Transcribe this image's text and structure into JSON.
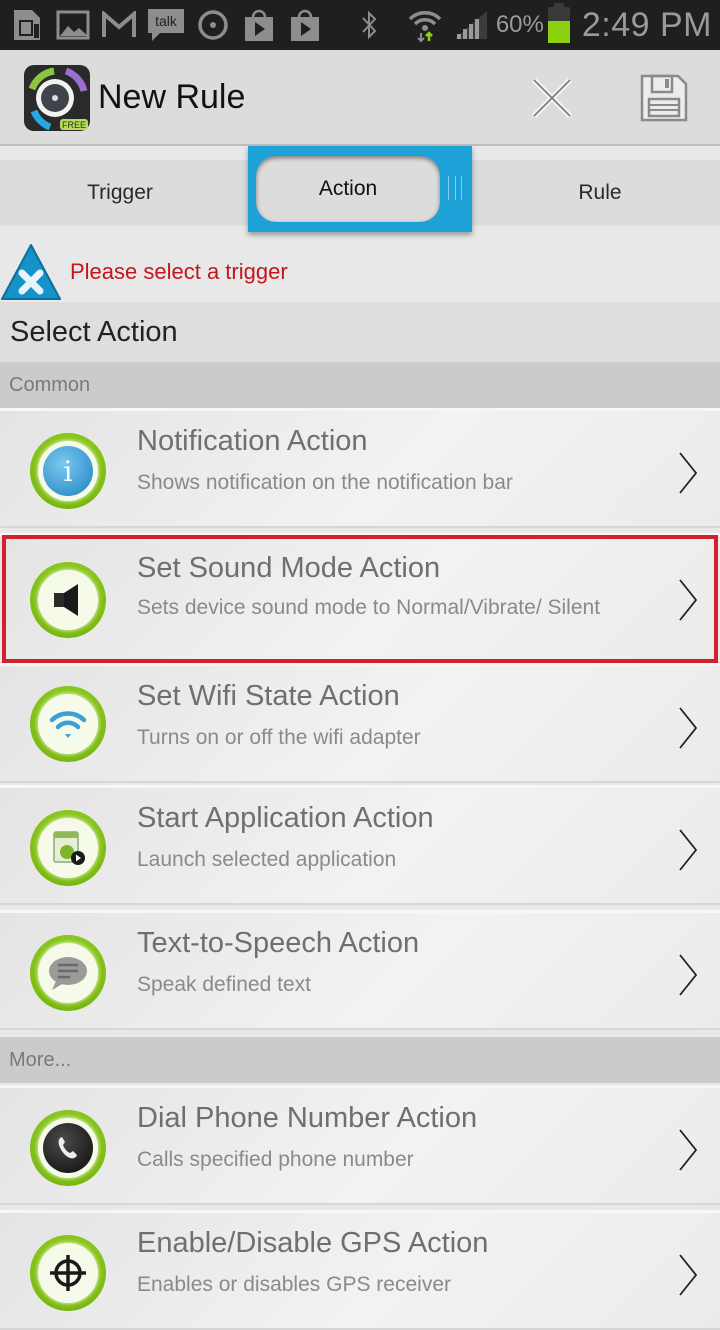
{
  "status_bar": {
    "notification_icons": [
      "sim-card-icon",
      "gallery-icon",
      "gmail-icon",
      "talk-icon",
      "music-icon",
      "play-store-icon",
      "play-store-icon"
    ],
    "talk_label": "talk",
    "battery_percent_text": "60%",
    "battery_level": 0.6,
    "time": "2:49 PM",
    "battery_color": "#8ed10f"
  },
  "action_bar": {
    "title": "New Rule",
    "logo_badge": "FREE",
    "close_icon": "close-icon",
    "save_icon": "save-icon"
  },
  "tabs": {
    "items": [
      {
        "label": "Trigger",
        "active": false
      },
      {
        "label": "Action",
        "active": true
      },
      {
        "label": "Rule",
        "active": false
      }
    ],
    "accent_color": "#1ea1d6"
  },
  "warning": {
    "text": "Please select a trigger",
    "color": "#c4161c"
  },
  "page": {
    "header": "Select Action"
  },
  "sections": [
    {
      "label": "Common",
      "items": [
        {
          "title": "Notification Action",
          "subtitle": "Shows notification on the notification bar",
          "icon": "info-icon"
        },
        {
          "title": "Set Sound Mode Action",
          "subtitle": "Sets device sound mode to Normal/Vibrate/ Silent",
          "icon": "speaker-icon",
          "highlighted": true
        },
        {
          "title": "Set Wifi State Action",
          "subtitle": "Turns on or off the wifi adapter",
          "icon": "wifi-icon"
        },
        {
          "title": "Start Application Action",
          "subtitle": "Launch selected application",
          "icon": "app-launch-icon"
        },
        {
          "title": "Text-to-Speech Action",
          "subtitle": "Speak defined text",
          "icon": "speech-bubble-icon"
        }
      ]
    },
    {
      "label": "More...",
      "items": [
        {
          "title": "Dial Phone Number Action",
          "subtitle": "Calls specified phone number",
          "icon": "phone-icon"
        },
        {
          "title": "Enable/Disable GPS Action",
          "subtitle": "Enables or disables GPS receiver",
          "icon": "gps-crosshair-icon"
        }
      ]
    }
  ],
  "highlight_color": "#d3202f"
}
